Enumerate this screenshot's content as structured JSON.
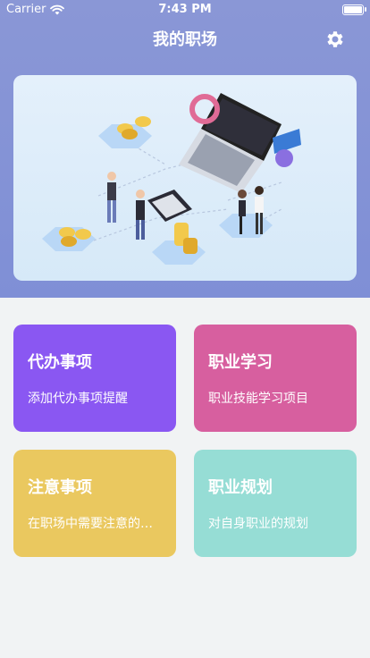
{
  "status_bar": {
    "carrier": "Carrier",
    "time": "7:43 PM"
  },
  "header": {
    "title": "我的职场",
    "settings_icon": "gear-icon"
  },
  "colors": {
    "header_bg": "#8a97d6",
    "card_1": "#8a57f2",
    "card_2": "#d75f9f",
    "card_3": "#eac85f",
    "card_4": "#96ddd5"
  },
  "cards": [
    {
      "title": "代办事项",
      "subtitle": "添加代办事项提醒"
    },
    {
      "title": "职业学习",
      "subtitle": "职业技能学习项目"
    },
    {
      "title": "注意事项",
      "subtitle": "在职场中需要注意的…"
    },
    {
      "title": "职业规划",
      "subtitle": "对自身职业的规划"
    }
  ]
}
